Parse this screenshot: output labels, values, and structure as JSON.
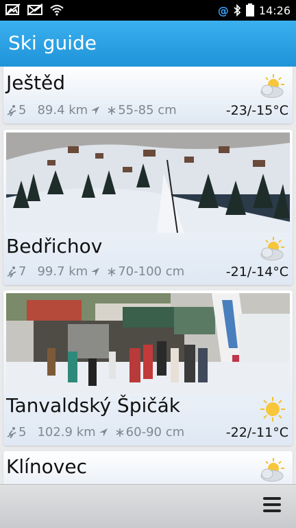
{
  "status": {
    "time": "14:26",
    "at_symbol": "@"
  },
  "header": {
    "title": "Ski guide"
  },
  "resorts": [
    {
      "name": "Ještěd",
      "lifts": "5",
      "distance": "89.4 km",
      "snow": "55-85 cm",
      "temp": "-23/-15°C",
      "weather": "sun-cloud-icon"
    },
    {
      "name": "Bedřichov",
      "lifts": "7",
      "distance": "99.7 km",
      "snow": "70-100 cm",
      "temp": "-21/-14°C",
      "weather": "sun-cloud-icon"
    },
    {
      "name": "Tanvaldský Špičák",
      "lifts": "5",
      "distance": "102.9 km",
      "snow": "60-90 cm",
      "temp": "-22/-11°C",
      "weather": "sun-icon"
    },
    {
      "name": "Klínovec",
      "weather": "sun-cloud-icon"
    }
  ],
  "colors": {
    "title_bar": "#1f93d8",
    "status_bar": "#000000",
    "secondary_text": "#7f8792"
  }
}
